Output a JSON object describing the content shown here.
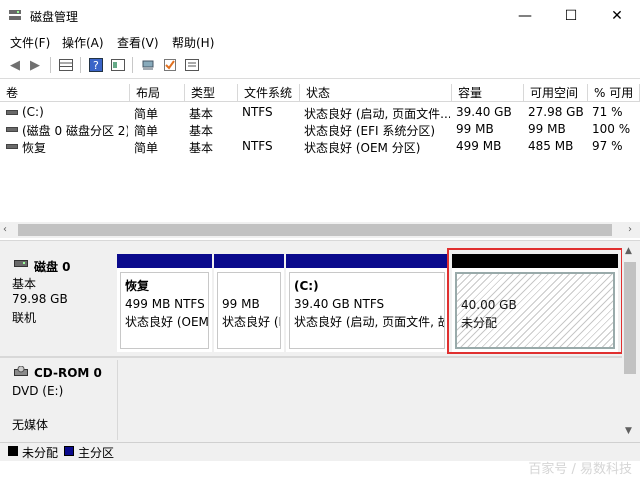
{
  "window": {
    "title": "磁盘管理",
    "minimize": "—",
    "maximize": "☐",
    "close": "✕"
  },
  "menu": [
    "文件(F)",
    "操作(A)",
    "查看(V)",
    "帮助(H)"
  ],
  "toolbar_icons": [
    "back-icon",
    "forward-icon",
    "disk-list-icon",
    "help-icon",
    "properties-icon",
    "connect-icon",
    "check-icon",
    "settings-icon"
  ],
  "volume_table": {
    "columns": [
      "卷",
      "布局",
      "类型",
      "文件系统",
      "状态",
      "容量",
      "可用空间",
      "% 可用"
    ],
    "rows": [
      [
        "(C:)",
        "简单",
        "基本",
        "NTFS",
        "状态良好 (启动, 页面文件...",
        "39.40 GB",
        "27.98 GB",
        "71 %"
      ],
      [
        "(磁盘 0 磁盘分区 2)",
        "简单",
        "基本",
        "",
        "状态良好 (EFI 系统分区)",
        "99 MB",
        "99 MB",
        "100 %"
      ],
      [
        "恢复",
        "简单",
        "基本",
        "NTFS",
        "状态良好 (OEM 分区)",
        "499 MB",
        "485 MB",
        "97 %"
      ]
    ]
  },
  "disk0": {
    "name": "磁盘 0",
    "type": "基本",
    "size": "79.98 GB",
    "status": "联机",
    "partitions": [
      {
        "name": "恢复",
        "size_fs": "499 MB NTFS",
        "status": "状态良好 (OEM"
      },
      {
        "name": "",
        "size_fs": "99 MB",
        "status": "状态良好 (I"
      },
      {
        "name": "(C:)",
        "size_fs": "39.40 GB NTFS",
        "status": "状态良好 (启动, 页面文件, 故"
      },
      {
        "name": "",
        "size_fs": "40.00 GB",
        "status": "未分配"
      }
    ]
  },
  "cdrom": {
    "name": "CD-ROM 0",
    "drive": "DVD (E:)",
    "media": "无媒体"
  },
  "legend": {
    "unallocated": "未分配",
    "primary": "主分区"
  },
  "colors": {
    "primary": "#0a0a8c",
    "unallocated": "#000000",
    "highlight": "#e03030"
  },
  "watermark": "百家号 / 易数科技"
}
